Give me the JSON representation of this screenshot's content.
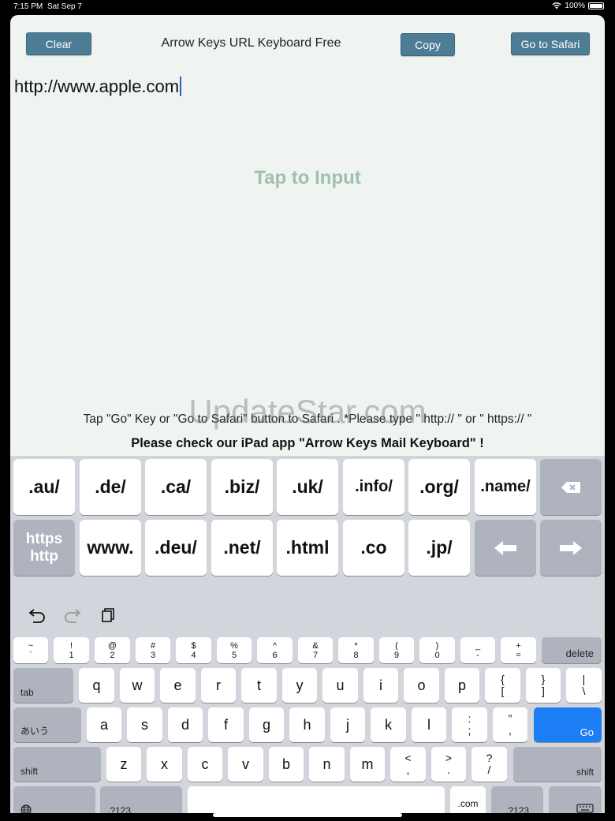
{
  "status_bar": {
    "time": "7:15 PM",
    "date": "Sat Sep 7",
    "battery": "100%"
  },
  "header": {
    "clear_label": "Clear",
    "title": "Arrow Keys URL Keyboard Free",
    "copy_label": "Copy",
    "safari_label": "Go to Safari"
  },
  "input": {
    "value": "http://www.apple.com"
  },
  "tap_to_input": "Tap to Input",
  "help_line1": "Tap \"Go\" Key or \"Go to Safari\" button to Safari .   *Please type \" http:// \" or \" https:// \"",
  "help_line2": "Please check our iPad app  \"Arrow Keys Mail Keyboard\" !",
  "watermark": "UpdateStar.com",
  "custom_keys_row1": [
    ".au/",
    ".de/",
    ".ca/",
    ".biz/",
    ".uk/",
    ".info/",
    ".org/",
    ".name/"
  ],
  "https_key": {
    "top": "https",
    "bottom": "http"
  },
  "custom_keys_row2": [
    "www.",
    ".deu/",
    ".net/",
    ".html",
    ".co",
    ".jp/"
  ],
  "number_row": [
    {
      "top": "~",
      "bottom": "`"
    },
    {
      "top": "!",
      "bottom": "1"
    },
    {
      "top": "@",
      "bottom": "2"
    },
    {
      "top": "#",
      "bottom": "3"
    },
    {
      "top": "$",
      "bottom": "4"
    },
    {
      "top": "%",
      "bottom": "5"
    },
    {
      "top": "^",
      "bottom": "6"
    },
    {
      "top": "&",
      "bottom": "7"
    },
    {
      "top": "*",
      "bottom": "8"
    },
    {
      "top": "(",
      "bottom": "9"
    },
    {
      "top": ")",
      "bottom": "0"
    },
    {
      "top": "_",
      "bottom": "-"
    },
    {
      "top": "+",
      "bottom": "="
    }
  ],
  "delete_label": "delete",
  "tab_label": "tab",
  "row_q": [
    "q",
    "w",
    "e",
    "r",
    "t",
    "y",
    "u",
    "i",
    "o",
    "p"
  ],
  "row_q_extra": [
    {
      "top": "{",
      "bottom": "["
    },
    {
      "top": "}",
      "bottom": "]"
    },
    {
      "top": "|",
      "bottom": "\\"
    }
  ],
  "kana_label": "あいう",
  "row_a": [
    "a",
    "s",
    "d",
    "f",
    "g",
    "h",
    "j",
    "k",
    "l"
  ],
  "row_a_extra": [
    {
      "top": ":",
      "bottom": ";"
    },
    {
      "top": "”",
      "bottom": ","
    }
  ],
  "go_label": "Go",
  "shift_label": "shift",
  "row_z": [
    "z",
    "x",
    "c",
    "v",
    "b",
    "n",
    "m"
  ],
  "row_z_extra": [
    {
      "top": "<",
      "bottom": ","
    },
    {
      "top": ">",
      "bottom": "."
    },
    {
      "top": "?",
      "bottom": "/"
    }
  ],
  "num_switch_label": ".?123",
  "dotcom_label": ".com",
  "icons": {
    "undo": "undo-icon",
    "redo": "redo-icon",
    "paste": "paste-icon",
    "globe": "globe-icon",
    "keyboard": "keyboard-hide-icon",
    "backspace": "backspace-icon",
    "left": "arrow-left-icon",
    "right": "arrow-right-icon"
  },
  "colors": {
    "button": "#4d7c95",
    "go_key": "#1c7ef5",
    "tap_hint": "#9fbfb1"
  }
}
